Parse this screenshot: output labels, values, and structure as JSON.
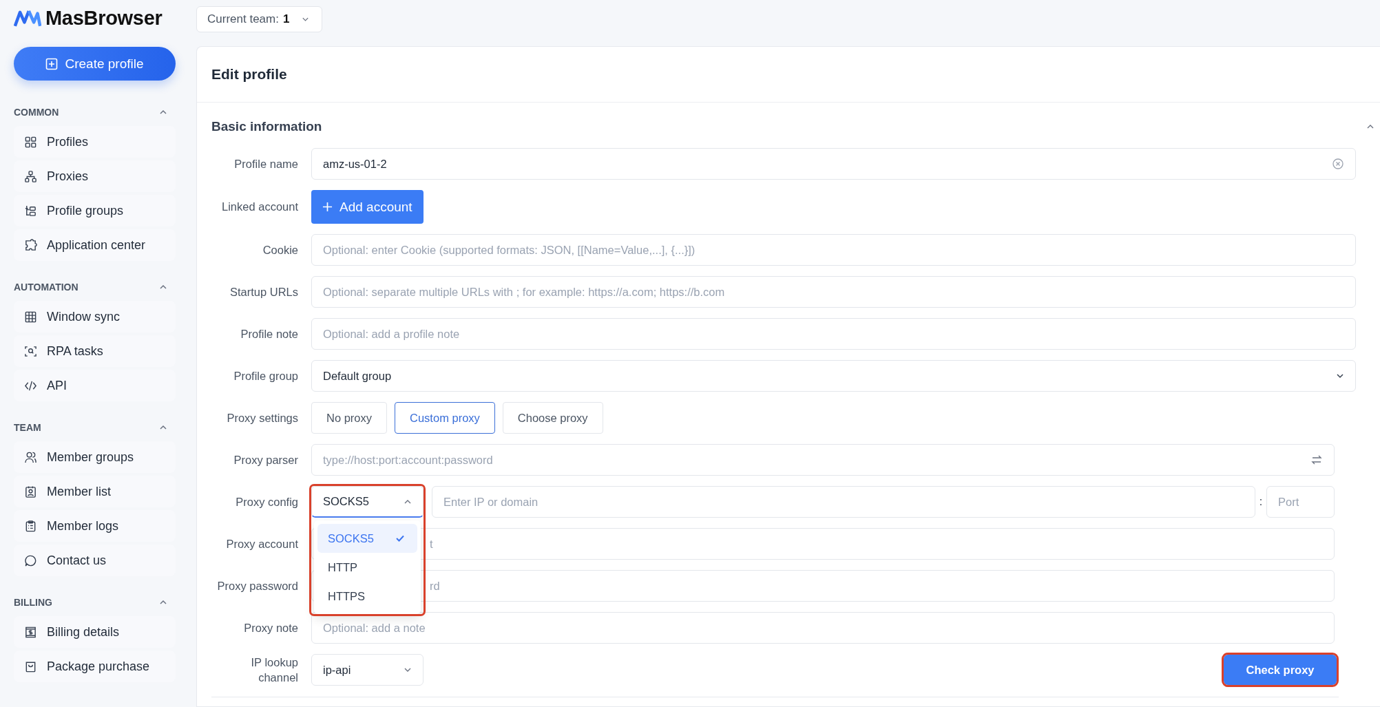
{
  "app": {
    "name": "MasBrowser"
  },
  "team_selector": {
    "label": "Current team:",
    "value": "1"
  },
  "create_button": {
    "label": "Create profile"
  },
  "sidebar": {
    "sections": [
      {
        "title": "COMMON",
        "expanded": true,
        "items": [
          {
            "label": "Profiles"
          },
          {
            "label": "Proxies"
          },
          {
            "label": "Profile groups"
          },
          {
            "label": "Application center"
          }
        ]
      },
      {
        "title": "AUTOMATION",
        "expanded": true,
        "items": [
          {
            "label": "Window sync"
          },
          {
            "label": "RPA tasks"
          },
          {
            "label": "API"
          }
        ]
      },
      {
        "title": "TEAM",
        "expanded": true,
        "items": [
          {
            "label": "Member groups"
          },
          {
            "label": "Member list"
          },
          {
            "label": "Member logs"
          },
          {
            "label": "Contact us"
          }
        ]
      },
      {
        "title": "BILLING",
        "expanded": true,
        "items": [
          {
            "label": "Billing details"
          },
          {
            "label": "Package purchase"
          }
        ]
      }
    ]
  },
  "form": {
    "title": "Edit profile",
    "section": {
      "title": "Basic information",
      "expanded": true
    },
    "fields": [
      {
        "kind": "text",
        "label": "Profile name",
        "value": "amz-us-01-2"
      },
      {
        "kind": "button",
        "label": "Linked account",
        "button": "Add account"
      },
      {
        "kind": "input",
        "label": "Cookie",
        "placeholder": "Optional: enter Cookie (supported formats: JSON, [[Name=Value,...], {...}])"
      },
      {
        "kind": "input",
        "label": "Startup URLs",
        "placeholder": "Optional: separate multiple URLs with ; for example: https://a.com; https://b.com"
      },
      {
        "kind": "input",
        "label": "Profile note",
        "placeholder": "Optional: add a profile note"
      },
      {
        "kind": "select",
        "label": "Profile group",
        "value": "Default group"
      },
      {
        "kind": "segmented",
        "label": "Proxy settings",
        "options": [
          {
            "label": "No proxy",
            "selected": false
          },
          {
            "label": "Custom proxy",
            "selected": true
          },
          {
            "label": "Choose proxy",
            "selected": false
          }
        ]
      },
      {
        "kind": "parser",
        "label": "Proxy parser",
        "placeholder": "type://host:port:account:password"
      },
      {
        "kind": "proxy_config",
        "label": "Proxy config",
        "value": "SOCKS5",
        "open": true,
        "highlighted": true,
        "options": [
          {
            "label": "SOCKS5",
            "selected": true
          },
          {
            "label": "HTTP",
            "selected": false
          },
          {
            "label": "HTTPS",
            "selected": false
          }
        ],
        "host_placeholder": "Enter IP or domain",
        "separator": ":",
        "port_placeholder": "Port"
      },
      {
        "kind": "covered",
        "label": "Proxy account",
        "placeholder": "t"
      },
      {
        "kind": "covered",
        "label": "Proxy password",
        "placeholder": "rd"
      },
      {
        "kind": "note",
        "label": "Proxy note",
        "placeholder": "Optional: add a note"
      },
      {
        "kind": "lookup",
        "label": "IP lookup channel",
        "value": "ip-api",
        "button": "Check proxy",
        "highlighted": true
      }
    ]
  }
}
